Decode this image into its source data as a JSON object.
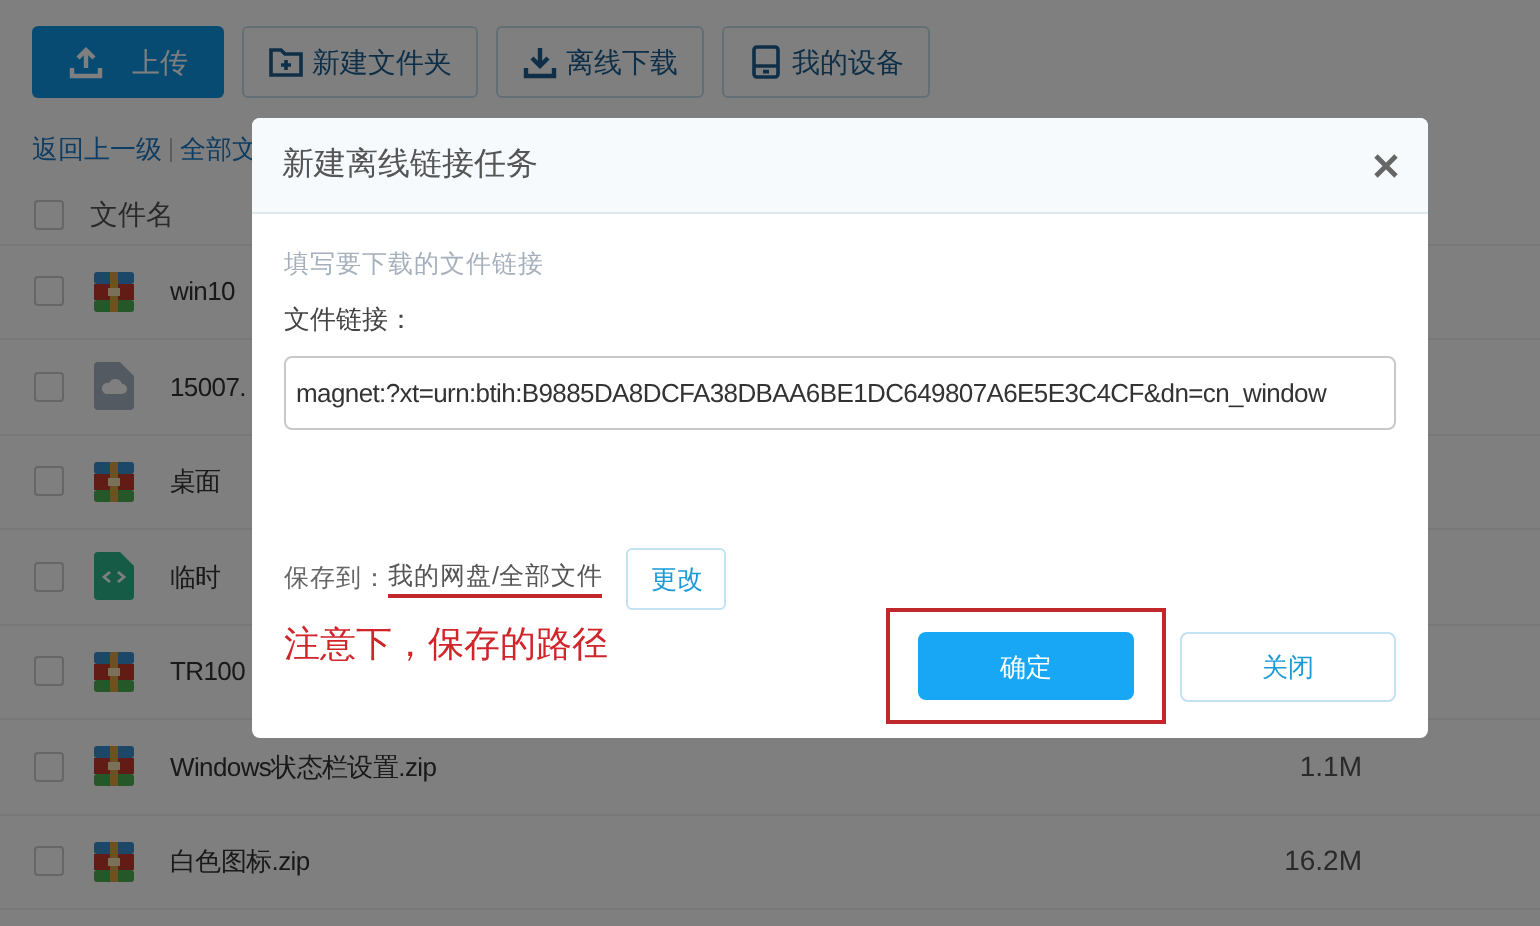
{
  "toolbar": [
    {
      "label": "上传",
      "kind": "upload",
      "primary": true
    },
    {
      "label": "新建文件夹",
      "kind": "folder",
      "primary": false
    },
    {
      "label": "离线下载",
      "kind": "download",
      "primary": false
    },
    {
      "label": "我的设备",
      "kind": "device",
      "primary": false
    }
  ],
  "breadcrumb": {
    "back": "返回上一级",
    "current": "全部文"
  },
  "file_list": {
    "header": "文件名",
    "all_checked": false,
    "rows": [
      {
        "name": "win10",
        "kind": "archive",
        "size": "",
        "checked": false
      },
      {
        "name": "15007.",
        "kind": "cloud",
        "size": "",
        "checked": false
      },
      {
        "name": "桌面",
        "kind": "archive",
        "size": "",
        "checked": false
      },
      {
        "name": "临时",
        "kind": "code",
        "size": "",
        "checked": false
      },
      {
        "name": "TR100",
        "kind": "archive",
        "size": "",
        "checked": false
      },
      {
        "name": "Windows状态栏设置.zip",
        "kind": "archive",
        "size": "1.1M",
        "checked": false
      },
      {
        "name": "白色图标.zip",
        "kind": "archive",
        "size": "16.2M",
        "checked": false
      }
    ]
  },
  "dialog": {
    "title": "新建离线链接任务",
    "hint": "填写要下载的文件链接",
    "link_label": "文件链接：",
    "link_value": "magnet:?xt=urn:btih:B9885DA8DCFA38DBAA6BE1DC649807A6E5E3C4CF&dn=cn_window",
    "save_label": "保存到：",
    "save_path": "我的网盘/全部文件",
    "change": "更改",
    "confirm": "确定",
    "close": "关闭"
  },
  "annotation": "注意下，保存的路径"
}
